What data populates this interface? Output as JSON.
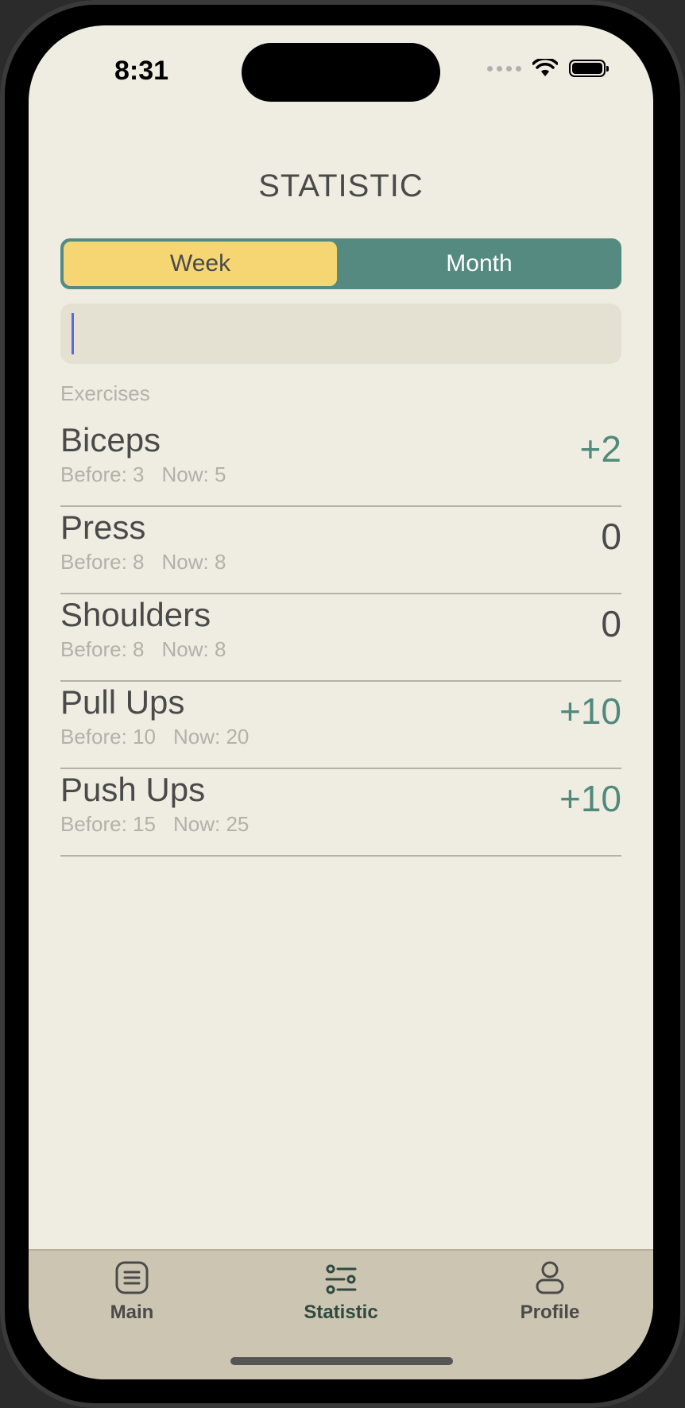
{
  "status_bar": {
    "time": "8:31"
  },
  "header": {
    "title": "STATISTIC"
  },
  "segmented": {
    "week": "Week",
    "month": "Month",
    "selected": "Week"
  },
  "search": {
    "value": "",
    "placeholder": ""
  },
  "section": {
    "label": "Exercises"
  },
  "exercises": [
    {
      "name": "Biceps",
      "before": "Before: 3",
      "now": "Now: 5",
      "delta": "+2"
    },
    {
      "name": "Press",
      "before": "Before: 8",
      "now": "Now: 8",
      "delta": "0"
    },
    {
      "name": "Shoulders",
      "before": "Before: 8",
      "now": "Now: 8",
      "delta": "0"
    },
    {
      "name": "Pull Ups",
      "before": "Before: 10",
      "now": "Now: 20",
      "delta": "+10"
    },
    {
      "name": "Push Ups",
      "before": "Before: 15",
      "now": "Now: 25",
      "delta": "+10"
    }
  ],
  "tabbar": {
    "items": [
      {
        "label": "Main",
        "icon": "list-icon"
      },
      {
        "label": "Statistic",
        "icon": "sliders-icon",
        "active": true
      },
      {
        "label": "Profile",
        "icon": "person-icon"
      }
    ]
  },
  "colors": {
    "accent": "#548a7f",
    "highlight": "#f5d673",
    "positive": "#4f8a7c",
    "background": "#efede2"
  }
}
